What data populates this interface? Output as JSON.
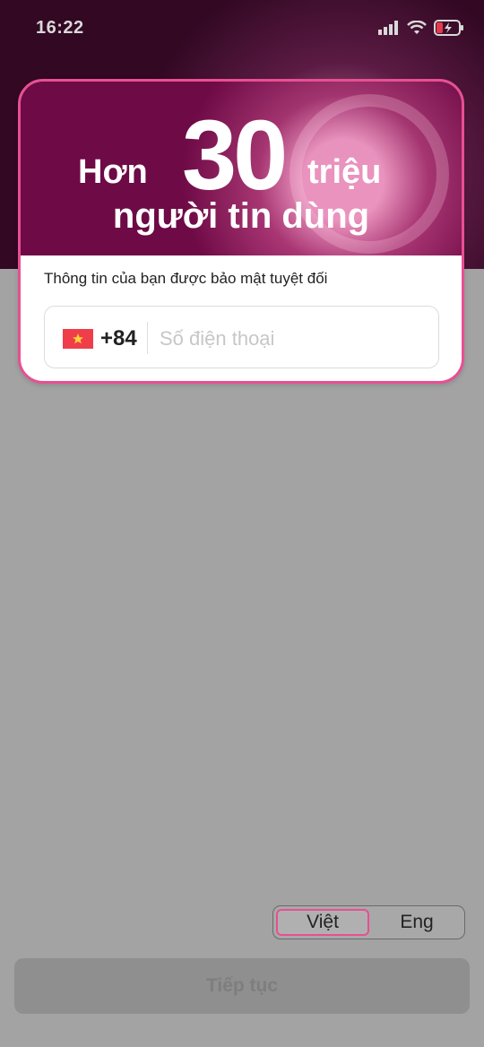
{
  "status_bar": {
    "time": "16:22",
    "icons": [
      "signal-icon",
      "wifi-icon",
      "battery-charging-icon"
    ]
  },
  "banner": {
    "line1_before": "Hơn",
    "line1_number": "30",
    "line1_after": "triệu",
    "line2": "người tin dùng"
  },
  "form": {
    "subtitle": "Thông tin của bạn được bảo mật tuyệt đối",
    "country_code": "+84",
    "phone_placeholder": "Số điện thoại",
    "phone_value": ""
  },
  "language": {
    "options": [
      "Việt",
      "Eng"
    ],
    "selected": "Việt"
  },
  "continue_label": "Tiếp tục",
  "colors": {
    "accent": "#e84f93",
    "backdrop": "#a3a3a3",
    "banner_dark": "#5b0a3f"
  }
}
